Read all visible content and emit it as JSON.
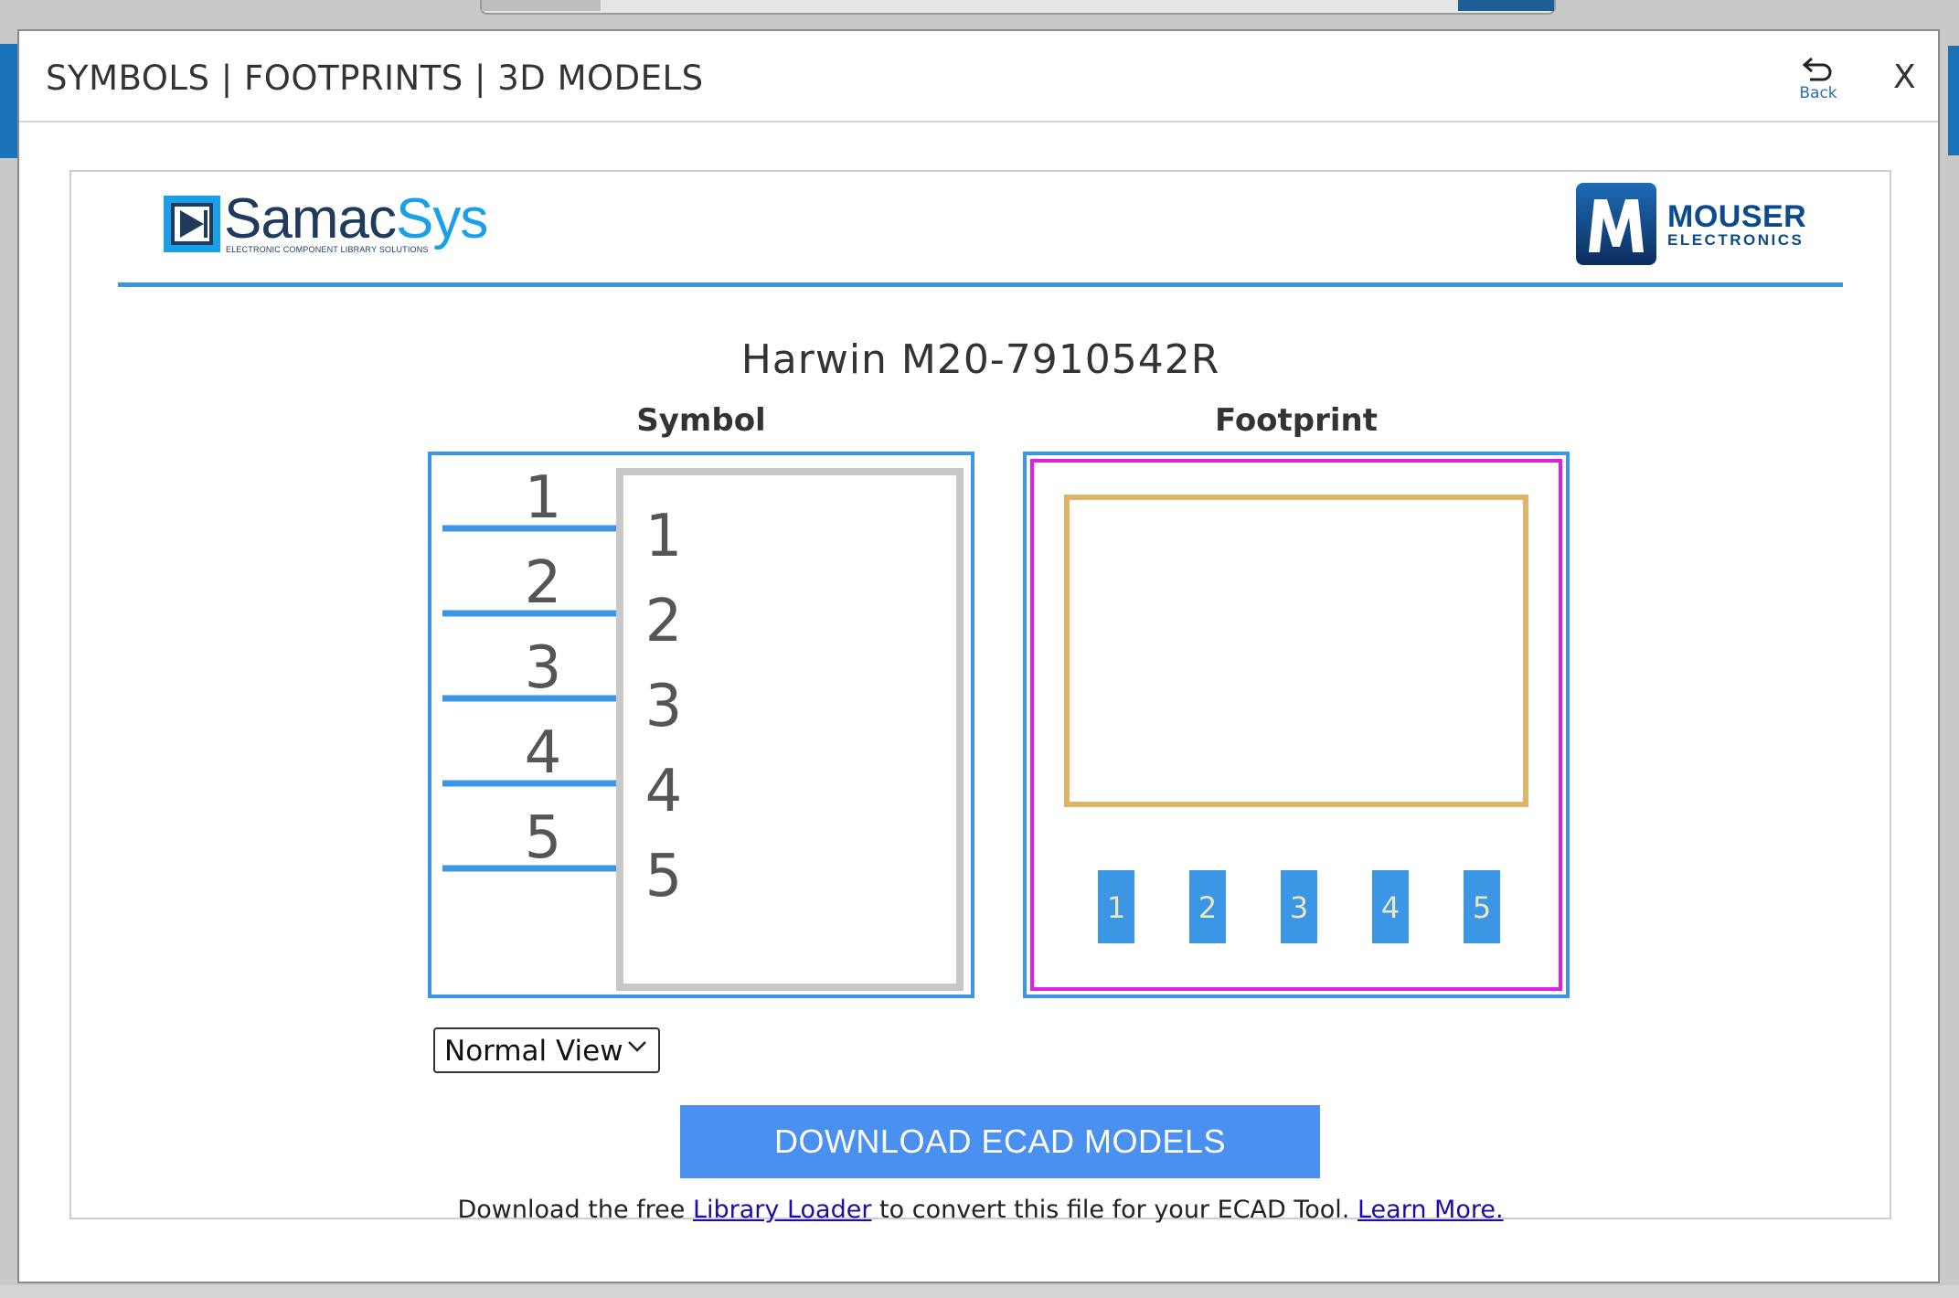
{
  "modal": {
    "title": "SYMBOLS | FOOTPRINTS | 3D MODELS",
    "back_label": "Back",
    "close_label": "X"
  },
  "brand": {
    "samacsys_name_part1": "Samac",
    "samacsys_name_part2": "Sys",
    "samacsys_tagline": "ELECTRONIC COMPONENT LIBRARY SOLUTIONS",
    "mouser_name": "MOUSER",
    "mouser_sub": "ELECTRONICS"
  },
  "part_title": "Harwin M20-7910542R",
  "symbol": {
    "label": "Symbol",
    "pin_numbers": [
      "1",
      "2",
      "3",
      "4",
      "5"
    ]
  },
  "footprint": {
    "label": "Footprint",
    "pad_numbers": [
      "1",
      "2",
      "3",
      "4",
      "5"
    ]
  },
  "view_select": {
    "value": "Normal View"
  },
  "download_button": "DOWNLOAD ECAD MODELS",
  "note": {
    "text1": "Download the free ",
    "link1": "Library Loader",
    "text2": " to convert this file for your ECAD Tool. ",
    "link2": "Learn More."
  },
  "colors": {
    "accent_blue": "#3c96e6",
    "button_blue": "#4a90f0",
    "footprint_outline": "#e020e0",
    "footprint_body": "#deb46a"
  }
}
